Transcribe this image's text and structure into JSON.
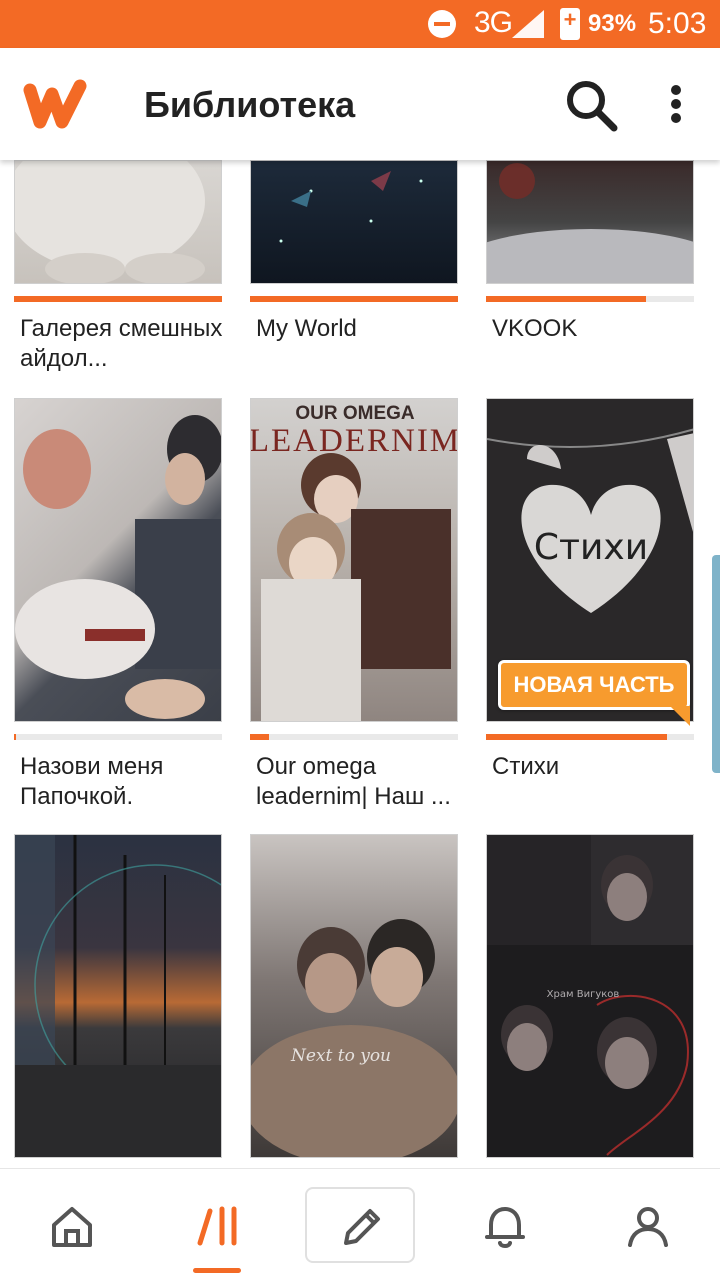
{
  "status_bar": {
    "network": "3G",
    "battery": "93%",
    "time": "5:03"
  },
  "header": {
    "title": "Библиотека",
    "logo_icon": "wattpad-w-logo",
    "search_icon": "search-icon",
    "menu_icon": "more-vertical-icon"
  },
  "library": {
    "books": [
      {
        "title": "Галерея смешных айдол...",
        "progress": 1.0
      },
      {
        "title": "My World",
        "progress": 1.0
      },
      {
        "title": "VKOOK",
        "progress": 0.77
      },
      {
        "title": "Назови меня Папочкой.",
        "progress": 0.01
      },
      {
        "title": "Our omega leadernim| Наш ...",
        "progress": 0.09,
        "cover_text": [
          "OUR OMEGA",
          "LEADERNIM"
        ]
      },
      {
        "title": "Стихи",
        "progress": 0.87,
        "cover_text": [
          "Стихи"
        ],
        "badge": "НОВАЯ ЧАСТЬ"
      },
      {
        "title": "",
        "progress": null
      },
      {
        "title": "",
        "progress": null,
        "cover_text": [
          "Next to you"
        ]
      },
      {
        "title": "",
        "progress": null,
        "cover_text": [
          "Храм Вигуков"
        ]
      }
    ]
  },
  "bottom_nav": {
    "items": [
      {
        "icon": "home-icon",
        "active": false
      },
      {
        "icon": "library-icon",
        "active": true
      },
      {
        "icon": "pencil-icon",
        "active": false
      },
      {
        "icon": "bell-icon",
        "active": false
      },
      {
        "icon": "profile-icon",
        "active": false
      }
    ]
  },
  "colors": {
    "accent": "#f36a25",
    "badge": "#f79b2e"
  }
}
